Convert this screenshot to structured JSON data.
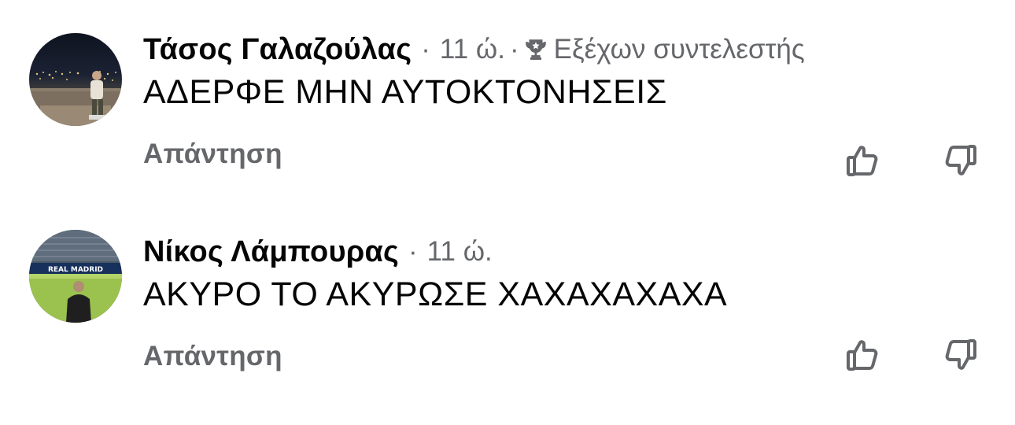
{
  "comments": [
    {
      "author": "Τάσος Γαλαζούλας",
      "time": "11 ώ.",
      "separator": "·",
      "badge": {
        "icon": "trophy-icon",
        "label": "Εξέχων συντελεστής"
      },
      "text": "ΑΔΕΡΦΕ ΜΗΝ ΑΥΤΟΚΤΟΝΗΣΕΙΣ",
      "reply_label": "Απάντηση",
      "avatar_icon": "night-city-photo"
    },
    {
      "author": "Νίκος Λάμπουρας",
      "time": "11 ώ.",
      "separator": "·",
      "text": "ΑΚΥΡΟ ΤΟ ΑΚΥΡΩΣΕ ΧΑΧΑΧΑΧΑΧΑ",
      "reply_label": "Απάντηση",
      "avatar_icon": "stadium-photo",
      "avatar_banner": "REAL MADRID"
    }
  ],
  "icons": {
    "upvote": "thumbs-up-icon",
    "downvote": "thumbs-down-icon"
  },
  "colors": {
    "text": "#050505",
    "secondary": "#65676b",
    "background": "#ffffff"
  }
}
